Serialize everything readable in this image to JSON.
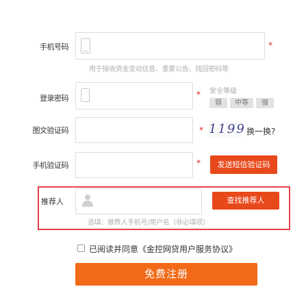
{
  "form": {
    "phone": {
      "label": "手机号码",
      "required": "*",
      "hint": "用于接收资金变动信息、重要公告、找回密码等"
    },
    "password": {
      "label": "登录密码",
      "required": "*",
      "strength_title": "安全等级",
      "strength_levels": [
        "弱",
        "中等",
        "强"
      ]
    },
    "captcha": {
      "label": "图文验证码",
      "required": "*",
      "image_text": "1199",
      "refresh_label": "换一换?"
    },
    "sms": {
      "label": "手机验证码",
      "required": "*",
      "button_label": "发送短信验证码"
    },
    "referrer": {
      "label": "推荐人",
      "button_label": "查找推荐人",
      "hint": "选填：推荐人手机号/用户名（非必填项）"
    },
    "agreement": {
      "prefix": "已阅读并同意",
      "link": "《金控网贷用户服务协议》"
    },
    "submit_label": "免费注册"
  },
  "colors": {
    "accent_orange": "#f26a18",
    "button_red_orange": "#e8491b",
    "highlight_frame": "#e6404d",
    "required_star": "#e02020"
  }
}
